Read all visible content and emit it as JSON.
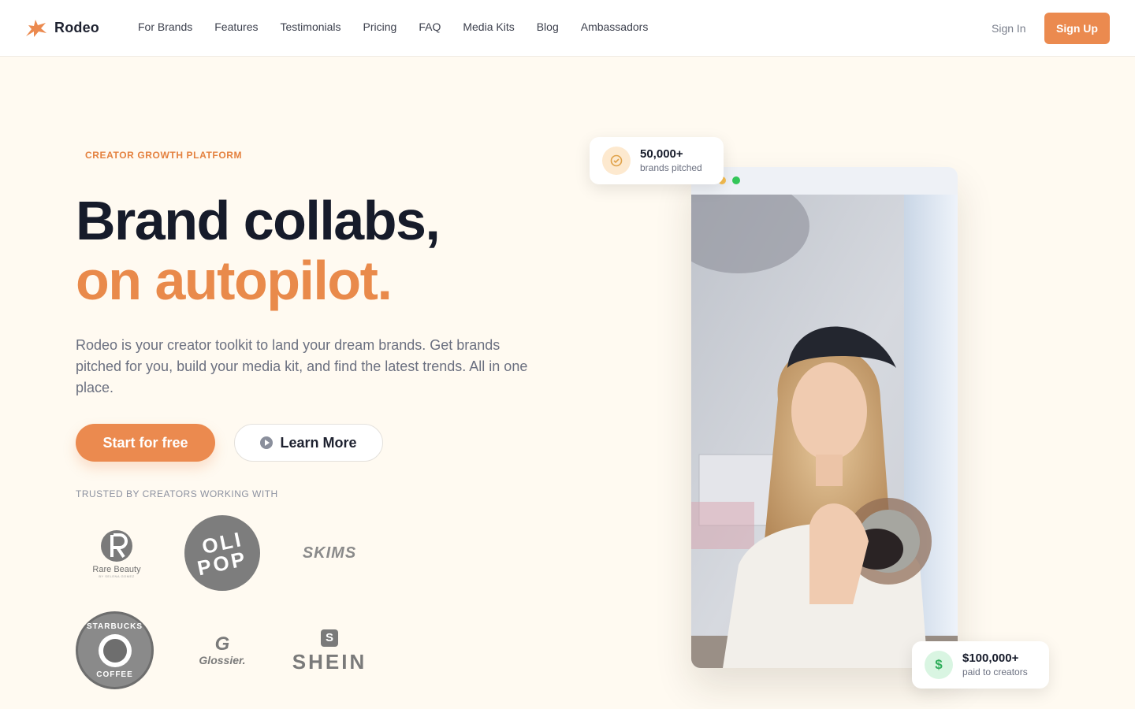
{
  "nav": {
    "brand": "Rodeo",
    "links": [
      "For Brands",
      "Features",
      "Testimonials",
      "Pricing",
      "FAQ",
      "Media Kits",
      "Blog",
      "Ambassadors"
    ],
    "sign_in": "Sign In",
    "sign_up": "Sign Up"
  },
  "hero": {
    "eyebrow": "CREATOR GROWTH PLATFORM",
    "headline_line1": "Brand collabs,",
    "headline_line2": "on autopilot.",
    "subcopy": "Rodeo is your creator toolkit to land your dream brands. Get brands pitched for you, build your media kit, and find the latest trends. All in one place.",
    "cta_primary": "Start for free",
    "cta_secondary": "Learn More",
    "trusted_label": "TRUSTED BY CREATORS WORKING WITH"
  },
  "brands": {
    "rare_beauty": "Rare Beauty",
    "rare_beauty_sub": "BY SELENA GOMEZ",
    "olipop_top": "OLI",
    "olipop_bottom": "POP",
    "skims": "SKIMS",
    "starbucks_top": "STARBUCKS",
    "starbucks_bottom": "COFFEE",
    "glossier_mark": "G",
    "glossier": "Glossier.",
    "shein_mark": "S",
    "shein": "SHEIN"
  },
  "stats": {
    "pitched_value": "50,000+",
    "pitched_label": "brands pitched",
    "paid_value": "$100,000+",
    "paid_label": "paid to creators",
    "paid_symbol": "$"
  },
  "colors": {
    "accent": "#eb8a4f",
    "background": "#fffaf1",
    "text": "#161b2a"
  }
}
